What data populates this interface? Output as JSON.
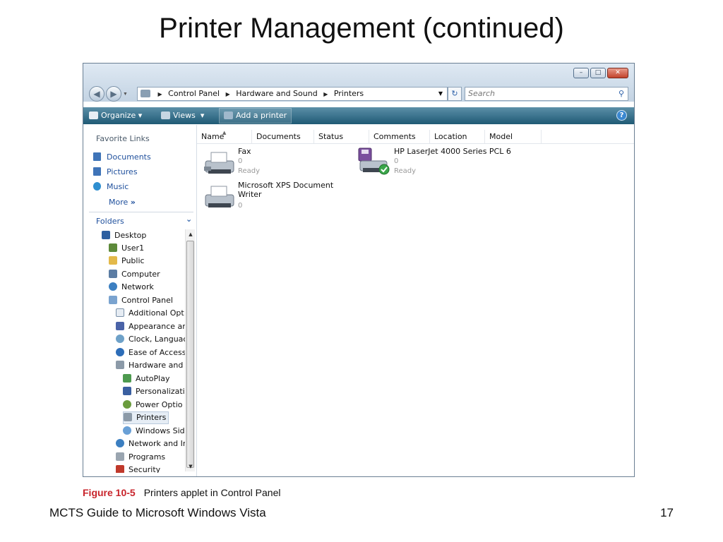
{
  "slide": {
    "title": "Printer Management (continued)",
    "caption_label": "Figure 10-5",
    "caption_text": "Printers applet in Control Panel",
    "footer": "MCTS Guide to Microsoft Windows Vista",
    "page_number": "17"
  },
  "window": {
    "buttons": {
      "minimize": "–",
      "maximize": "□",
      "close": "✕"
    },
    "address": {
      "crumbs": [
        "Control Panel",
        "Hardware and Sound",
        "Printers"
      ]
    },
    "search_placeholder": "Search",
    "toolbar": {
      "organize": "Organize",
      "views": "Views",
      "add_printer": "Add a printer",
      "help": "?"
    },
    "favorite_links": {
      "title": "Favorite Links",
      "items": [
        "Documents",
        "Pictures",
        "Music"
      ],
      "more": "More"
    },
    "folders": {
      "title": "Folders",
      "tree": [
        "Desktop",
        "User1",
        "Public",
        "Computer",
        "Network",
        "Control Panel",
        "Additional Opt",
        "Appearance ar",
        "Clock, Languac",
        "Ease of Access",
        "Hardware and",
        "AutoPlay",
        "Personalizati",
        "Power Optio",
        "Printers",
        "Windows Sid",
        "Network and Ir",
        "Programs",
        "Security"
      ]
    },
    "columns": [
      "Name",
      "Documents",
      "Status",
      "Comments",
      "Location",
      "Model"
    ],
    "printers": [
      {
        "name": "Fax",
        "docs": "0",
        "status": "Ready"
      },
      {
        "name": "HP LaserJet 4000 Series PCL 6",
        "docs": "0",
        "status": "Ready"
      },
      {
        "name": "Microsoft XPS Document Writer",
        "docs": "0",
        "status": ""
      }
    ],
    "colors": {
      "toolbar": "#1f5a75",
      "link": "#1e4f9c",
      "figure_label": "#c8242b"
    },
    "icons": [
      "back-icon",
      "forward-icon",
      "refresh-icon",
      "search-icon",
      "printer-icon",
      "help-icon"
    ]
  }
}
